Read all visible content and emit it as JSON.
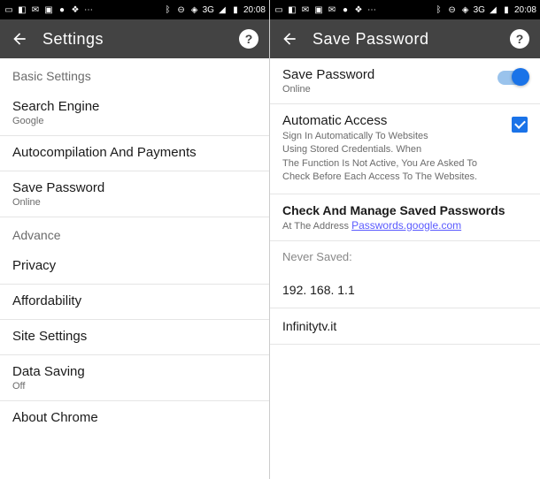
{
  "status": {
    "time": "20:08",
    "network": "3G"
  },
  "left": {
    "title": "Settings",
    "sections": {
      "basic_header": "Basic Settings",
      "search": {
        "title": "Search Engine",
        "subtitle": "Google"
      },
      "autocomp": "Autocompilation And Payments",
      "savepw": {
        "title": "Save Password",
        "subtitle": "Online"
      },
      "advance_header": "Advance",
      "privacy": "Privacy",
      "affordability": "Affordability",
      "site_settings": "Site Settings",
      "data_saving": {
        "title": "Data Saving",
        "subtitle": "Off"
      },
      "about": "About Chrome"
    }
  },
  "right": {
    "title": "Save Password",
    "savepw": {
      "title": "Save Password",
      "subtitle": "Online"
    },
    "auto_access": {
      "title": "Automatic Access",
      "desc1": "Sign In Automatically To Websites",
      "desc2": "Using Stored Credentials. When",
      "desc3": "The Function Is Not Active, You Are Asked To Check Before Each Access To The Websites."
    },
    "manage": {
      "title": "Check And Manage Saved Passwords",
      "link_prefix": "At The Address ",
      "link": "Passwords.google.com"
    },
    "never_saved_label": "Never Saved:",
    "entries": [
      "192. 168. 1.1",
      "Infinitytv.it"
    ]
  }
}
